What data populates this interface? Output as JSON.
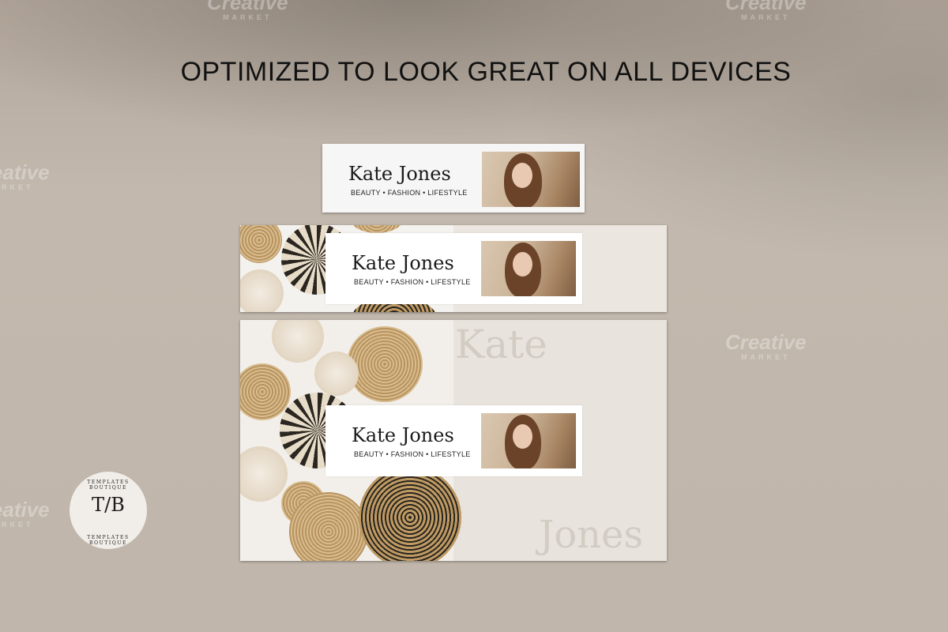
{
  "headline": "OPTIMIZED TO LOOK GREAT ON ALL DEVICES",
  "profile": {
    "name": "Kate Jones",
    "tagline": "BEAUTY • FASHION • LIFESTYLE"
  },
  "backdrop_words": {
    "word1": "Kate",
    "word2": "Jones"
  },
  "watermark": {
    "brand": "Creative",
    "sub": "MARKET"
  },
  "logo": {
    "monogram": "T/B",
    "ring_text": "TEMPLATES BOUTIQUE"
  },
  "colors": {
    "background": "#bdb2a7",
    "card": "#ffffff",
    "text": "#111111"
  }
}
